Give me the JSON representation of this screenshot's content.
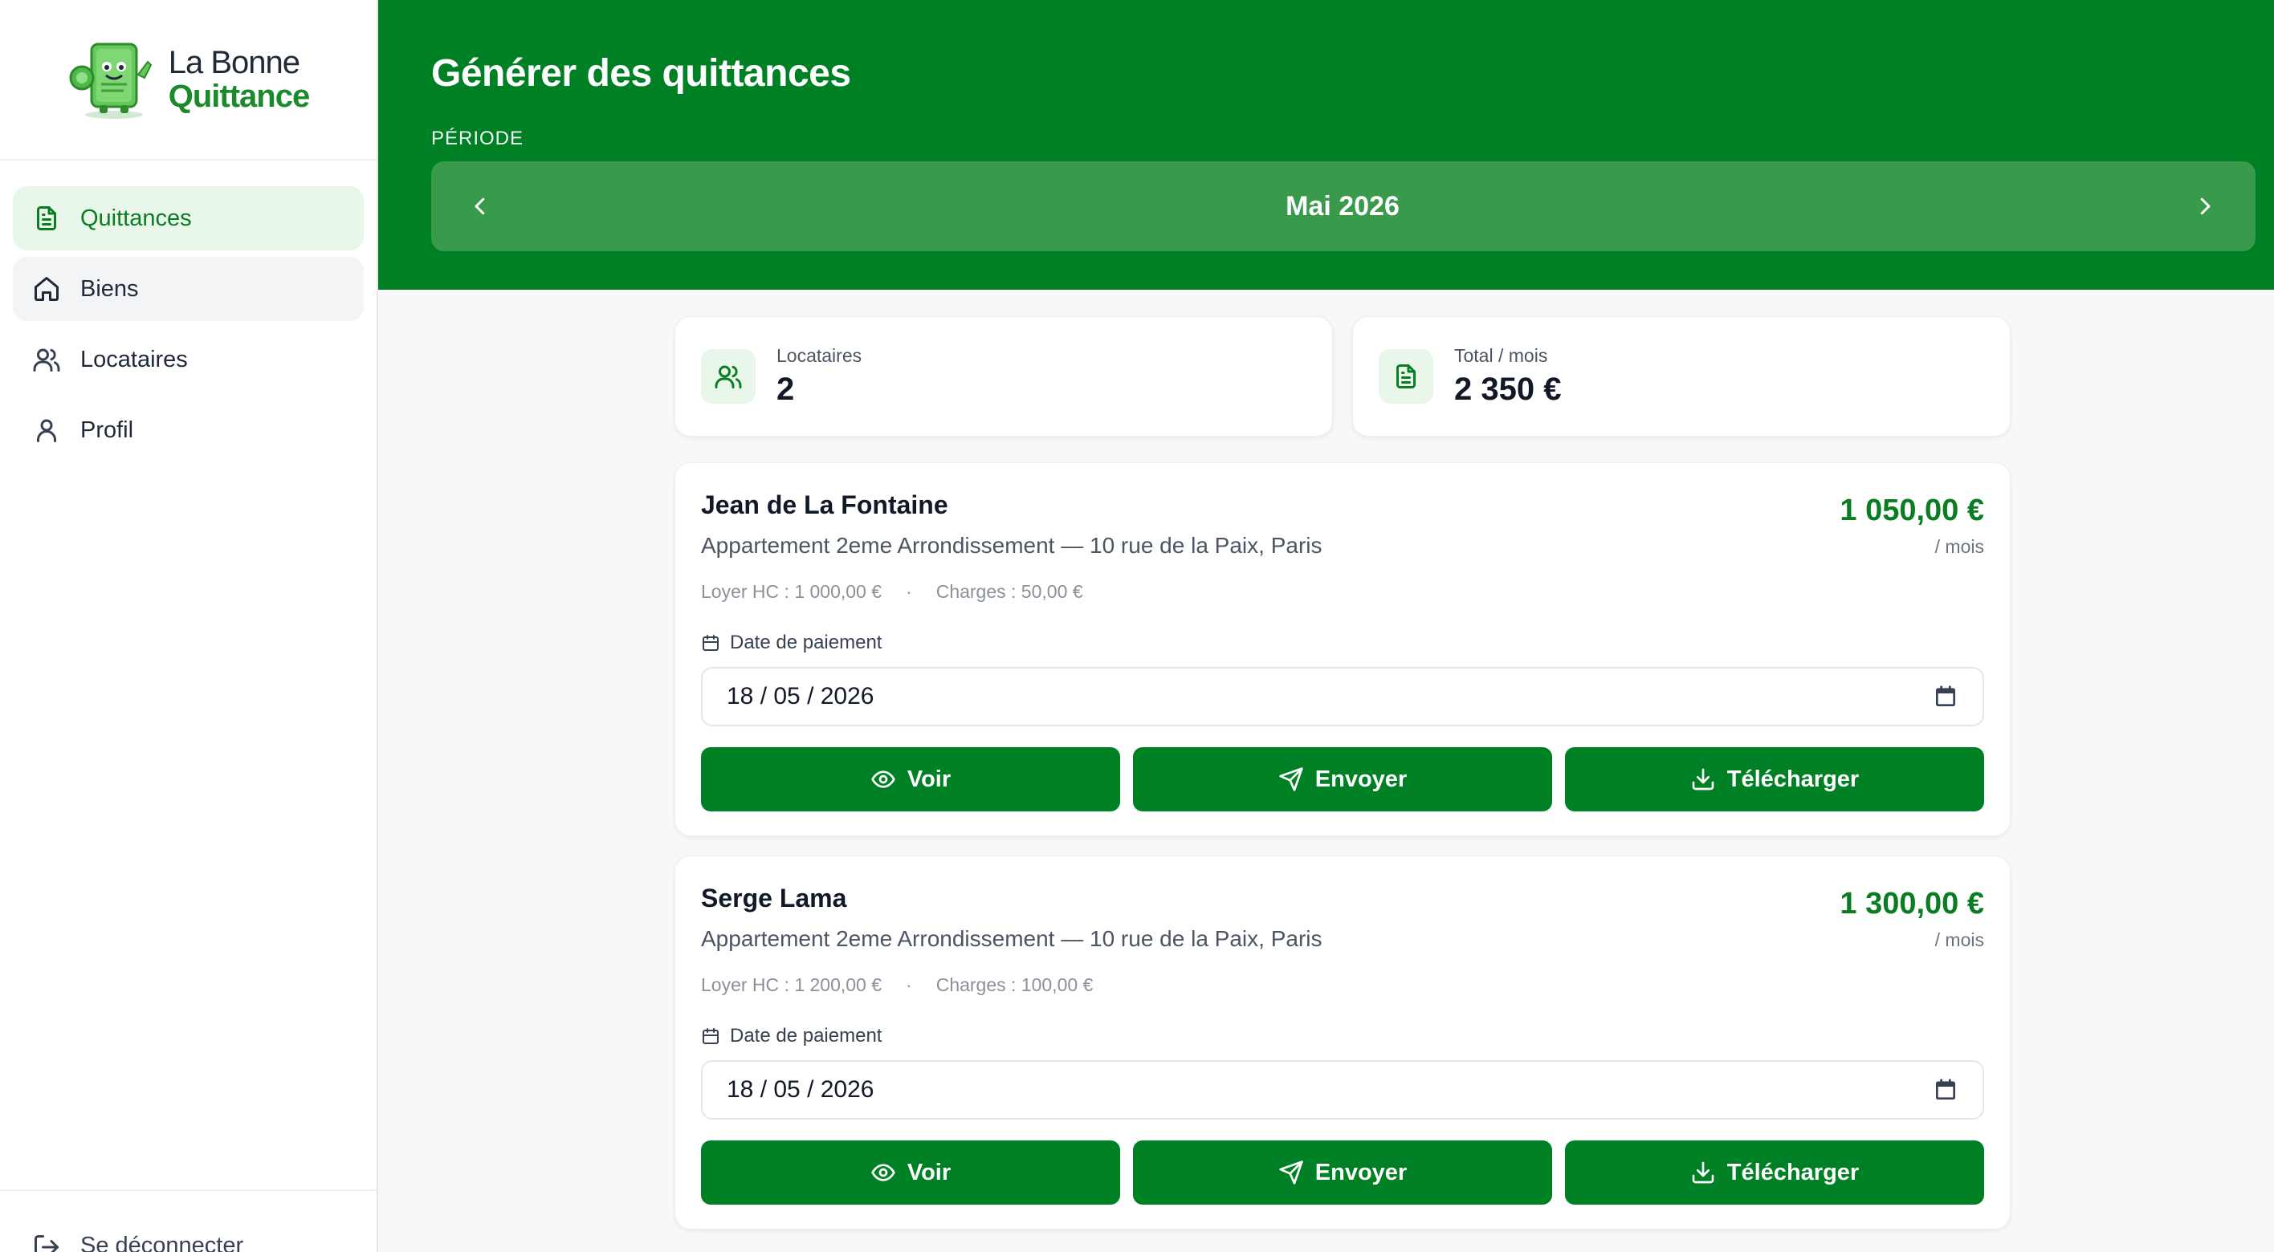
{
  "brand": {
    "line1": "La Bonne",
    "line2": "Quittance"
  },
  "sidebar": {
    "items": [
      {
        "label": "Quittances",
        "icon": "document-icon",
        "active": true
      },
      {
        "label": "Biens",
        "icon": "home-icon"
      },
      {
        "label": "Locataires",
        "icon": "users-icon"
      },
      {
        "label": "Profil",
        "icon": "user-icon"
      }
    ],
    "logout_label": "Se déconnecter"
  },
  "header": {
    "title": "Générer des quittances",
    "period_label": "PÉRIODE",
    "period_value": "Mai 2026"
  },
  "stats": {
    "tenants": {
      "label": "Locataires",
      "value": "2"
    },
    "total": {
      "label": "Total / mois",
      "value": "2 350 €"
    }
  },
  "tenants": [
    {
      "name": "Jean de La Fontaine",
      "address": "Appartement 2eme Arrondissement — 10 rue de la Paix, Paris",
      "amount": "1 050,00 €",
      "per": "/ mois",
      "rent": "Loyer HC : 1 000,00 €",
      "separator": "·",
      "charges": "Charges : 50,00 €",
      "date_label": "Date de paiement",
      "date_value": "18 / 05 / 2026"
    },
    {
      "name": "Serge Lama",
      "address": "Appartement 2eme Arrondissement — 10 rue de la Paix, Paris",
      "amount": "1 300,00 €",
      "per": "/ mois",
      "rent": "Loyer HC : 1 200,00 €",
      "separator": "·",
      "charges": "Charges : 100,00 €",
      "date_label": "Date de paiement",
      "date_value": "18 / 05 / 2026"
    }
  ],
  "actions": {
    "view": "Voir",
    "send": "Envoyer",
    "download": "Télécharger"
  },
  "colors": {
    "primary": "#008024",
    "primary_light": "#3a9a4b",
    "accent_bg": "#e9f6ea",
    "amount": "#0a7d22"
  }
}
